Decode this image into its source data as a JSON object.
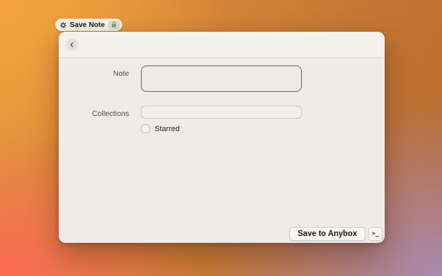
{
  "colors": {
    "gradient_top_left": "#f2a33e",
    "gradient_top_right": "#b5672f",
    "gradient_bottom_left": "#fb6a55",
    "gradient_bottom_right": "#a98bb2",
    "window_bg": "#edecea",
    "lock_green": "#7c9b6e"
  },
  "status_pill": {
    "label": "Save Note",
    "gear_icon": "gear-icon",
    "lock_icon": "lock-icon"
  },
  "window": {
    "header": {
      "back_icon": "chevron-left-icon"
    },
    "form": {
      "note": {
        "label": "Note",
        "value": "",
        "placeholder": ""
      },
      "collections": {
        "label": "Collections",
        "value": "",
        "placeholder": ""
      },
      "starred": {
        "label": "Starred",
        "checked": false
      }
    },
    "footer": {
      "primary_label": "Save to Anybox",
      "terminal_glyph": ">_"
    }
  }
}
